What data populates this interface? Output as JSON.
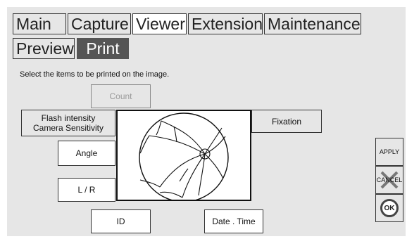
{
  "tabs": [
    "Main",
    "Capture",
    "Viewer",
    "Extension",
    "Maintenance"
  ],
  "subtabs": [
    "Preview",
    "Print"
  ],
  "instruction": "Select the items to be printed on the image.",
  "options": {
    "count": "Count",
    "flash_line1": "Flash intensity",
    "flash_line2": "Camera Sensitivity",
    "fixation": "Fixation",
    "angle": "Angle",
    "lr": "L / R",
    "id": "ID",
    "datetime": "Date . Time"
  },
  "side_buttons": {
    "apply": "APPLY",
    "cancel": "CANCEL",
    "ok": "OK"
  }
}
